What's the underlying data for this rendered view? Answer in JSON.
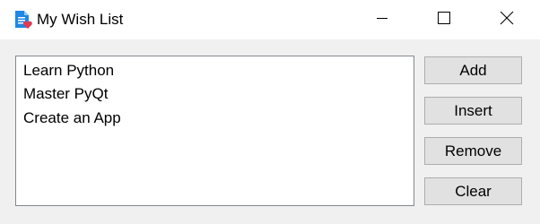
{
  "window": {
    "title": "My Wish List",
    "app_icon": "document-heart-icon",
    "controls": {
      "minimize": "minimize-icon",
      "maximize": "maximize-icon",
      "close": "close-icon"
    }
  },
  "wish_list": {
    "items": [
      "Learn Python",
      "Master PyQt",
      "Create an App"
    ]
  },
  "buttons": {
    "add": "Add",
    "insert": "Insert",
    "remove": "Remove",
    "clear": "Clear"
  },
  "colors": {
    "icon_blue": "#1e88e5",
    "icon_heart": "#e53950",
    "window_bg": "#f0f0f0",
    "button_bg": "#e1e1e1",
    "button_border": "#adadad"
  }
}
